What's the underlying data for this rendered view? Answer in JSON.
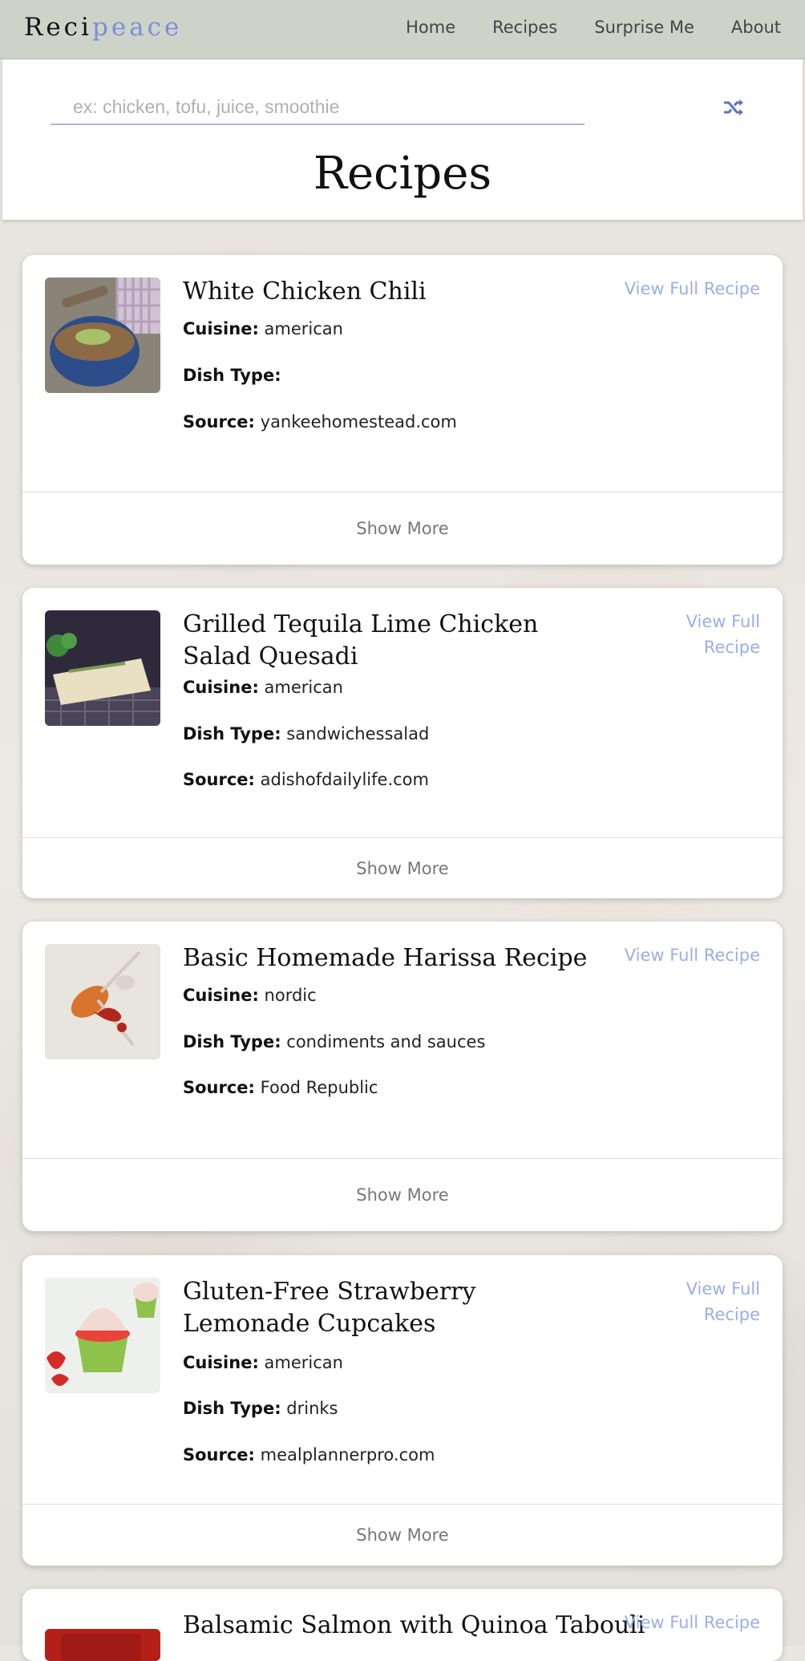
{
  "nav": {
    "brand_part1": "Reci",
    "brand_part2": "peace",
    "links": [
      "Home",
      "Recipes",
      "Surprise Me",
      "About"
    ]
  },
  "search": {
    "placeholder": "ex: chicken, tofu, juice, smoothie",
    "shuffle_icon": "shuffle-icon"
  },
  "page": {
    "title": "Recipes"
  },
  "labels": {
    "cuisine": "Cuisine:",
    "dish_type": "Dish Type:",
    "source": "Source:",
    "show_more": "Show More"
  },
  "recipes": [
    {
      "title": "White Chicken Chili",
      "cuisine": "american",
      "dish_type": "",
      "source": "yankeehomestead.com",
      "view_link": "View Full Recipe"
    },
    {
      "title": "Grilled Tequila Lime Chicken Salad Quesadi",
      "cuisine": "american",
      "dish_type": "sandwichessalad",
      "source": "adishofdailylife.com",
      "view_link": "View Full Recipe"
    },
    {
      "title": "Basic Homemade Harissa Recipe",
      "cuisine": "nordic",
      "dish_type": "condiments and sauces",
      "source": "Food Republic",
      "view_link": "View Full Recipe"
    },
    {
      "title": "Gluten-Free Strawberry Lemonade Cupcakes",
      "cuisine": "american",
      "dish_type": "drinks",
      "source": "mealplannerpro.com",
      "view_link": "View Full Recipe"
    },
    {
      "title": "Balsamic Salmon with Quinoa Tabouli",
      "view_link": "View Full Recipe"
    }
  ],
  "colors": {
    "accent": "#7a8fd6",
    "link": "#9aaee8",
    "navbar_bg": "#cdd3c9"
  }
}
